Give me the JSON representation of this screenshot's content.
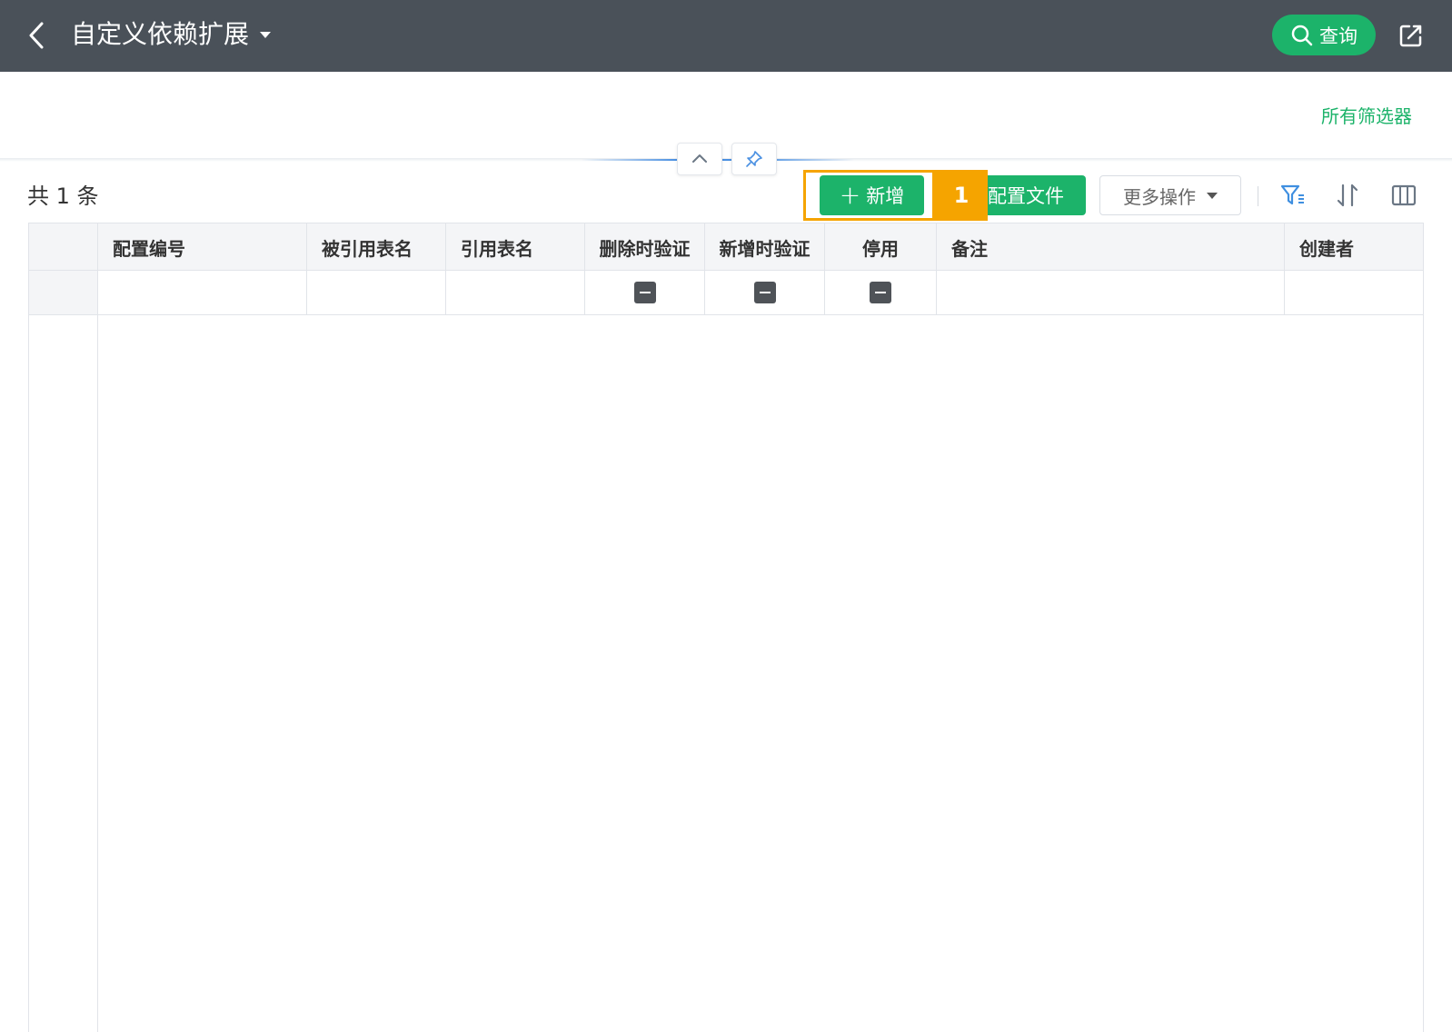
{
  "header": {
    "title": "自定义依赖扩展",
    "query_label": "查询"
  },
  "filters": {
    "all_filters_label": "所有筛选器"
  },
  "toolbar": {
    "record_count": "共 1 条",
    "add_label": "新增",
    "config_label": "配置文件",
    "more_label": "更多操作",
    "step_badge": "1"
  },
  "table": {
    "columns": [
      "配置编号",
      "被引用表名",
      "引用表名",
      "删除时验证",
      "新增时验证",
      "停用",
      "备注",
      "创建者"
    ]
  },
  "icons": {
    "back": "chevron-left-icon",
    "query": "search-icon",
    "export": "external-link-icon",
    "collapse": "chevron-up-icon",
    "pin": "pin-icon",
    "filter": "filter-icon",
    "sort": "sort-icon",
    "columns": "columns-icon",
    "tri_state": "indeterminate-checkbox-icon"
  },
  "colors": {
    "header_bg": "#4a5159",
    "accent_green": "#1cb36a",
    "highlight_orange": "#f5a400",
    "link_blue": "#4a90e2"
  }
}
